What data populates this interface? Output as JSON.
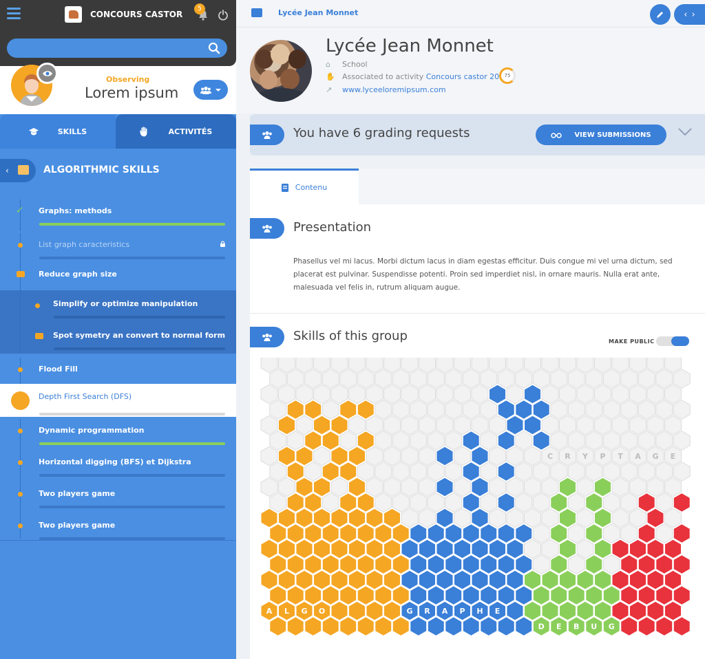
{
  "app": {
    "brand": "CONCOURS CASTOR",
    "notifications": "5",
    "search_placeholder": ""
  },
  "profile": {
    "status": "Observing",
    "name": "Lorem ipsum"
  },
  "sidebar": {
    "tabs": [
      {
        "label": "SKILLS"
      },
      {
        "label": "ACTIVITÉS"
      }
    ],
    "category": "ALGORITHMIC SKILLS",
    "items": [
      {
        "label": "Graphs: methods"
      },
      {
        "label": "List graph caracteristics"
      },
      {
        "label": "Reduce graph size"
      },
      {
        "label": "Simplify or optimize manipulation"
      },
      {
        "label": "Spot symetry an convert to normal form"
      },
      {
        "label": "Flood Fill"
      },
      {
        "label": "Depth First Search (DFS)"
      },
      {
        "label": "Dynamic programmation"
      },
      {
        "label": "Horizontal digging (BFS) et Dijkstra"
      },
      {
        "label": "Two players game"
      },
      {
        "label": "Two players game"
      }
    ]
  },
  "header": {
    "breadcrumb": "Lycée Jean Monnet"
  },
  "school": {
    "name": "Lycée Jean Monnet",
    "type": "School",
    "associated_prefix": "Associated to activity",
    "activity": "Concours castor 2018",
    "score": "75",
    "website": "www.lyceeloremipsum.com"
  },
  "grading": {
    "text": "You have 6 grading requests",
    "button": "VIEW SUBMISSIONS"
  },
  "content": {
    "tab": "Contenu",
    "presentation_title": "Presentation",
    "presentation_text": "Phasellus vel mi lacus. Morbi dictum lacus in diam egestas efficitur. Duis congue mi vel urna dictum, sed placerat est pulvinar. Suspendisse potenti. Proin sed imperdiet nisl, in ornare mauris. Nulla erat ante, malesuada vel felis in, rutrum aliquam augue.",
    "skills_title": "Skills of this group",
    "make_public": "MAKE PUBLIC"
  },
  "hexmap": {
    "colors": {
      "algo": "#f5a623",
      "graphe": "#3a7fd8",
      "debug": "#8bcf5b",
      "red": "#e8323c",
      "cryptage": "#f2f2f2"
    },
    "labels": [
      {
        "text": "ALGO",
        "letters": [
          "A",
          "L",
          "G",
          "O"
        ]
      },
      {
        "text": "GRAPHE",
        "letters": [
          "G",
          "R",
          "A",
          "P",
          "H",
          "E"
        ]
      },
      {
        "text": "DEBUG",
        "letters": [
          "D",
          "E",
          "B",
          "U",
          "G"
        ]
      },
      {
        "text": "CRYPTAGE",
        "letters": [
          "C",
          "R",
          "Y",
          "P",
          "T",
          "A",
          "G",
          "E"
        ]
      }
    ]
  }
}
